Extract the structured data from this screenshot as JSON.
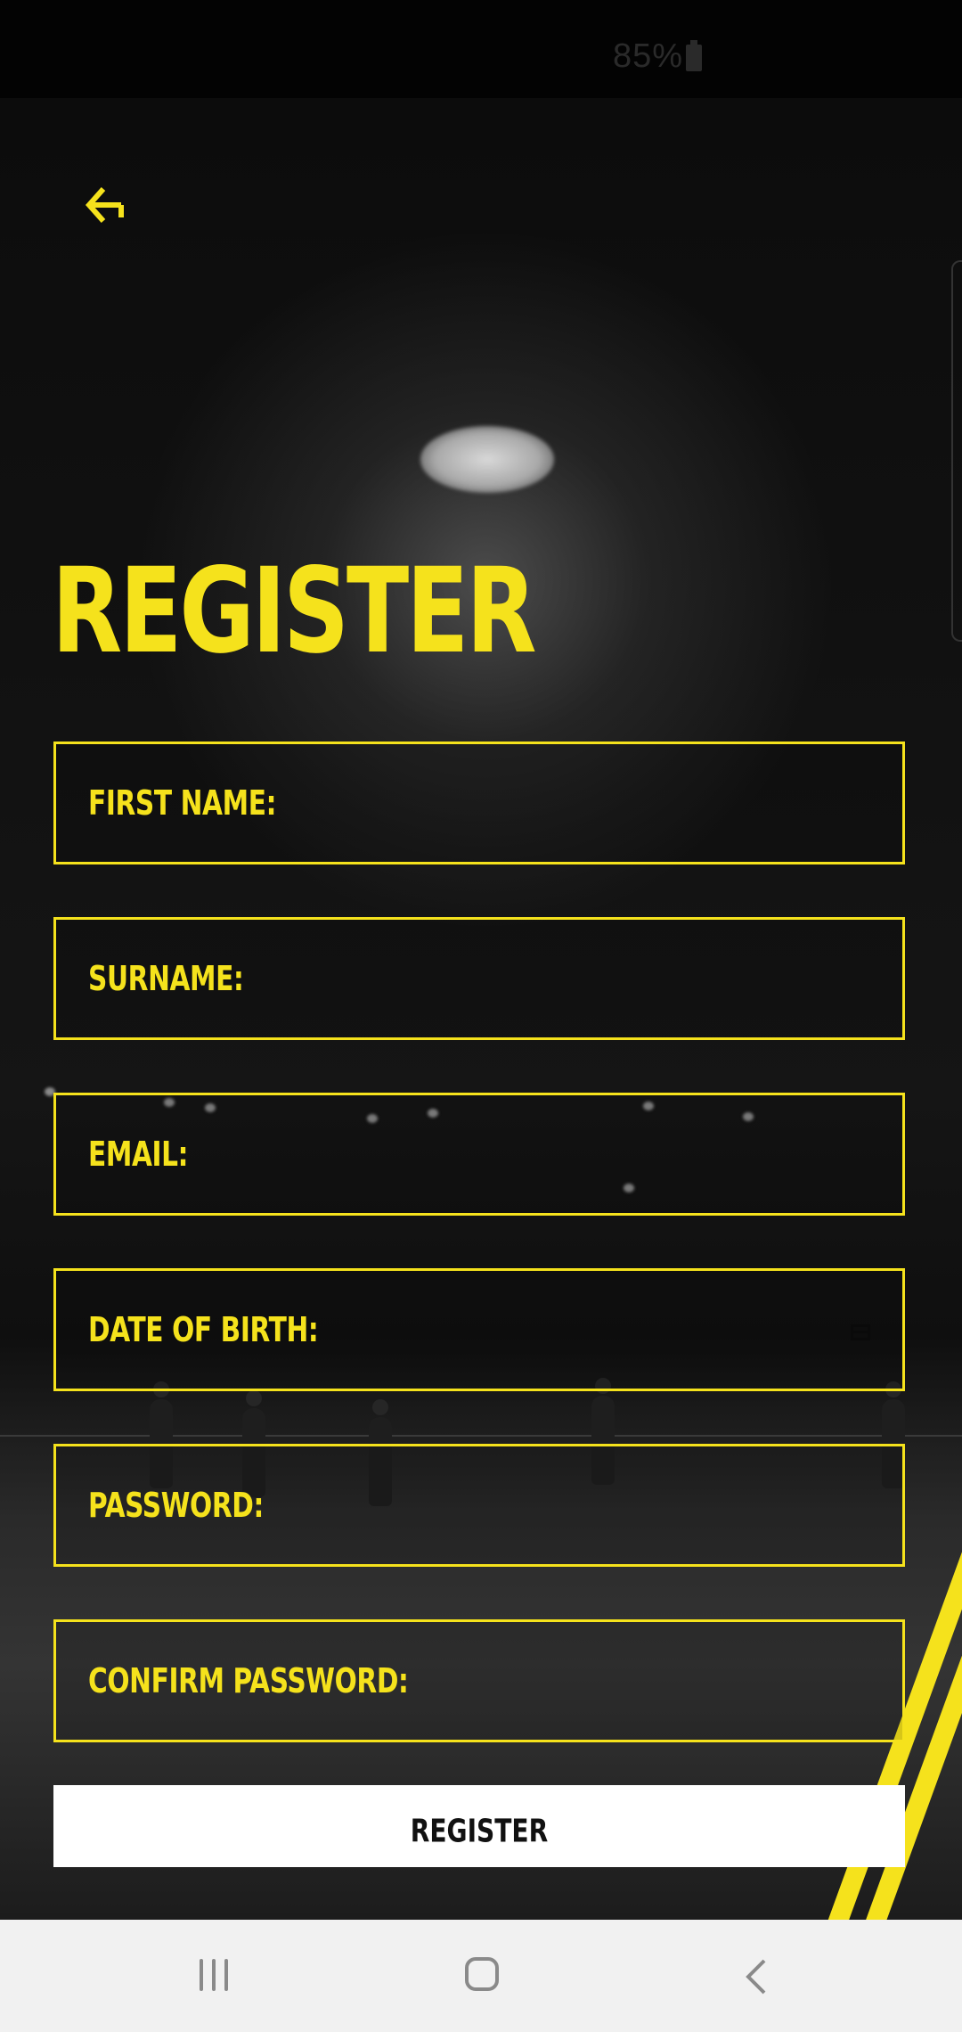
{
  "status_bar": {
    "battery_text": "85%"
  },
  "header": {
    "back_icon": "back-arrow-icon"
  },
  "page": {
    "title": "REGISTER"
  },
  "form": {
    "fields": [
      {
        "label": "FIRST NAME:"
      },
      {
        "label": "SURNAME:"
      },
      {
        "label": "EMAIL:"
      },
      {
        "label": "DATE OF BIRTH:"
      },
      {
        "label": "PASSWORD:"
      },
      {
        "label": "CONFIRM PASSWORD:"
      }
    ],
    "submit_label": "REGISTER"
  },
  "nav_bar": {
    "recent_icon": "recent-apps-icon",
    "home_icon": "home-icon",
    "back_icon": "nav-back-icon"
  },
  "colors": {
    "accent": "#f5e21c",
    "background": "#0b0b0b",
    "button": "#ffffff"
  }
}
